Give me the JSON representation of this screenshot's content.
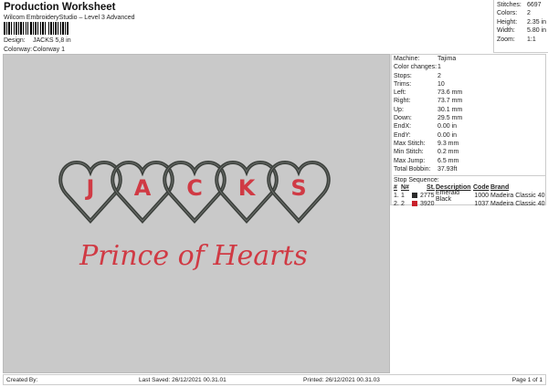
{
  "header": {
    "title": "Production Worksheet",
    "subtitle": "Wilcom EmbroideryStudio – Level 3 Advanced",
    "design_label": "Design:",
    "design_value": "JACKS 5,8 in",
    "colorway_label": "Colorway:",
    "colorway_value": "Colorway 1"
  },
  "stats": [
    {
      "k": "Stitches:",
      "v": "6697"
    },
    {
      "k": "Colors:",
      "v": "2"
    },
    {
      "k": "Height:",
      "v": "2.35 in"
    },
    {
      "k": "Width:",
      "v": "5.80 in"
    },
    {
      "k": "Zoom:",
      "v": "1:1"
    }
  ],
  "design": {
    "lettering": "JACKS",
    "letters": [
      "J",
      "A",
      "C",
      "K",
      "S"
    ],
    "script": "Prince of Hearts",
    "colors": {
      "outline": "#3b3f3b",
      "fill": "#d03a44",
      "background": "#c9c9c9"
    }
  },
  "panel": {
    "rows": [
      {
        "k": "Machine:",
        "v": "Tajima"
      },
      {
        "k": "Color changes:",
        "v": "1"
      },
      {
        "k": "Stops:",
        "v": "2"
      },
      {
        "k": "Trims:",
        "v": "10"
      },
      {
        "k": "Left:",
        "v": "73.6 mm"
      },
      {
        "k": "Right:",
        "v": "73.7 mm"
      },
      {
        "k": "Up:",
        "v": "30.1 mm"
      },
      {
        "k": "Down:",
        "v": "29.5 mm"
      },
      {
        "k": "EndX:",
        "v": "0.00 in"
      },
      {
        "k": "EndY:",
        "v": "0.00 in"
      },
      {
        "k": "Max Stitch:",
        "v": "9.3 mm"
      },
      {
        "k": "Min Stitch:",
        "v": "0.2 mm"
      },
      {
        "k": "Max Jump:",
        "v": "6.5 mm"
      },
      {
        "k": "Total Bobbin:",
        "v": "37.93ft"
      }
    ],
    "stop_sequence_label": "Stop Sequence:",
    "columns": [
      "#",
      "N#",
      "St.",
      "Description",
      "Code",
      "Brand"
    ],
    "stops": [
      {
        "num": "1.",
        "n": "1",
        "color": "#2a2a2a",
        "st": "2775",
        "desc": "Emerald Black",
        "code": "1000",
        "brand": "Madeira Classic 40"
      },
      {
        "num": "2.",
        "n": "2",
        "color": "#c8202a",
        "st": "3920",
        "desc": "",
        "code": "1037",
        "brand": "Madeira Classic 40"
      }
    ]
  },
  "footer": {
    "created_by": "Created By:",
    "last_saved": "Last Saved: 26/12/2021 00.31.01",
    "printed": "Printed: 26/12/2021 00.31.03",
    "page": "Page 1 of 1"
  }
}
